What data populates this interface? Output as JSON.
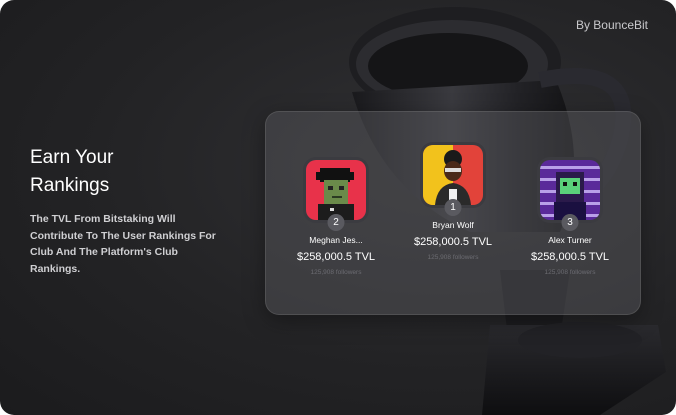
{
  "brand": "By BounceBit",
  "headline": "Earn Your Rankings",
  "description": "The TVL From Bitstaking Will Contribute To The User Rankings For Club And The Platform's Club Rankings.",
  "leaderboard": [
    {
      "rank": "2",
      "name": "Meghan Jes...",
      "tvl": "$258,000.5 TVL",
      "followers": "125,908 followers"
    },
    {
      "rank": "1",
      "name": "Bryan Wolf",
      "tvl": "$258,000.5 TVL",
      "followers": "125,908 followers"
    },
    {
      "rank": "3",
      "name": "Alex Turner",
      "tvl": "$258,000.5 TVL",
      "followers": "125,908 followers"
    }
  ]
}
